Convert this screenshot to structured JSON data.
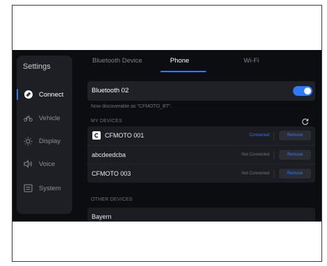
{
  "sidebar": {
    "title": "Settings",
    "items": [
      {
        "label": "Connect",
        "icon": "link-icon",
        "active": true
      },
      {
        "label": "Vehicle",
        "icon": "motorcycle-icon",
        "active": false
      },
      {
        "label": "Display",
        "icon": "sun-icon",
        "active": false
      },
      {
        "label": "Voice",
        "icon": "speaker-icon",
        "active": false
      },
      {
        "label": "System",
        "icon": "system-icon",
        "active": false
      }
    ]
  },
  "tabs": [
    {
      "label": "Bluetooth Device",
      "active": false
    },
    {
      "label": "Phone",
      "active": true
    },
    {
      "label": "Wi-Fi",
      "active": false
    }
  ],
  "bluetooth": {
    "name": "Bluetooth 02",
    "enabled": true,
    "discoverable_note": "Now discoverable as \"CFMOTO_BT\"."
  },
  "my_devices": {
    "label": "MY DEVICES",
    "devices": [
      {
        "name": "CFMOTO 001",
        "status": "Connected",
        "action": "Remove",
        "icon": "cfmoto-icon"
      },
      {
        "name": "abcdeedcba",
        "status": "Not Connected",
        "action": "Remove"
      },
      {
        "name": "CFMOTO 003",
        "status": "Not Connected",
        "action": "Remove"
      }
    ]
  },
  "other_devices": {
    "label": "OTHER DEVICES",
    "devices": [
      {
        "name": "Bayern"
      }
    ]
  },
  "colors": {
    "accent": "#2e7bff",
    "background": "#0c0d10",
    "panel": "#1d1f24"
  }
}
